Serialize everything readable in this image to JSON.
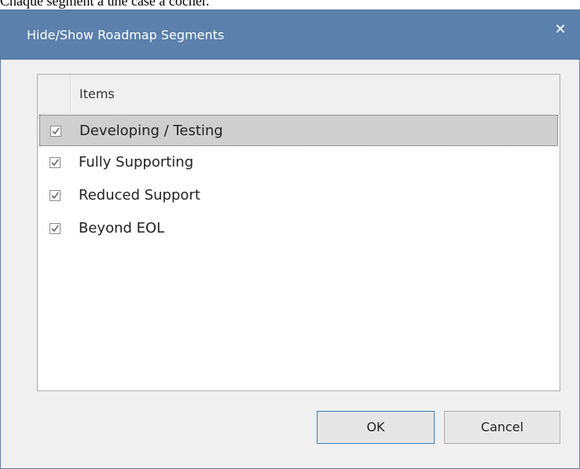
{
  "page": {
    "caption": "Chaque segment a une case à cocher."
  },
  "dialog": {
    "title": "Hide/Show Roadmap Segments",
    "close_glyph": "✕"
  },
  "list": {
    "header": "Items",
    "items": [
      {
        "label": "Developing / Testing",
        "checked": true,
        "selected": true
      },
      {
        "label": "Fully Supporting",
        "checked": true,
        "selected": false
      },
      {
        "label": "Reduced Support",
        "checked": true,
        "selected": false
      },
      {
        "label": "Beyond EOL",
        "checked": true,
        "selected": false
      }
    ]
  },
  "buttons": {
    "ok_label": "OK",
    "cancel_label": "Cancel"
  },
  "colors": {
    "titlebar": "#5a80ab",
    "dialog_bg": "#f0f0f0",
    "selected_row": "#cfcfcf"
  },
  "icons": {
    "close": "close-icon",
    "check": "checkmark-icon"
  }
}
